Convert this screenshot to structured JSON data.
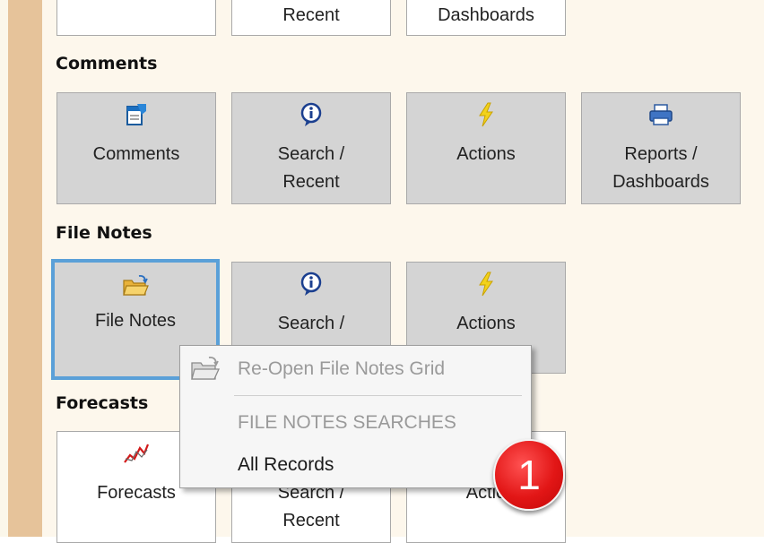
{
  "sections": {
    "comments": "Comments",
    "file_notes": "File Notes",
    "forecasts": "Forecasts"
  },
  "top_row": {
    "search_recent": "Recent",
    "reports_dashboards": "Dashboards"
  },
  "comments_row": {
    "comments": "Comments",
    "search_recent": "Search /\nRecent",
    "actions": "Actions",
    "reports_dashboards": "Reports /\nDashboards"
  },
  "file_notes_row": {
    "file_notes": "File Notes",
    "search_recent": "Search /",
    "actions": "Actions"
  },
  "forecasts_row": {
    "forecasts": "Forecasts",
    "search_recent": "Search /\nRecent",
    "actions": "Actio"
  },
  "context_menu": {
    "reopen": "Re-Open File Notes Grid",
    "searches_header": "FILE NOTES  SEARCHES",
    "all_records": "All Records"
  },
  "badge_number": "1",
  "icons": {
    "comments": "comment-note-icon",
    "search": "info-search-icon",
    "actions": "lightning-bolt-icon",
    "reports": "printer-icon",
    "file_notes": "folder-open-icon",
    "forecasts": "chart-line-icon"
  },
  "colors": {
    "tile_gray": "#d4d4d4",
    "selected_border": "#5aa0d8",
    "panel_bg": "#fdf7ec",
    "left_stripe": "#e6c39a",
    "badge_red": "#e21616"
  }
}
